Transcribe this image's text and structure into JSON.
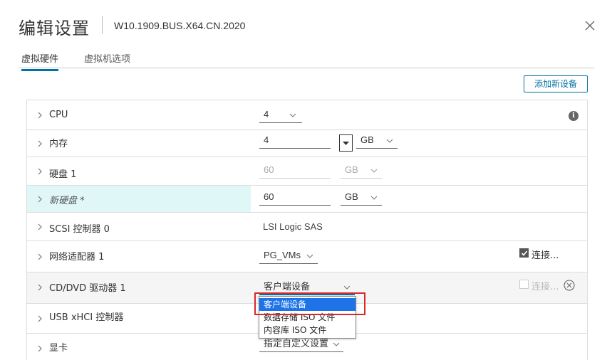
{
  "dialog": {
    "title": "编辑设置",
    "subtitle": "W10.1909.BUS.X64.CN.2020",
    "close_icon": "close-icon"
  },
  "tabs": [
    {
      "label": "虚拟硬件",
      "active": true
    },
    {
      "label": "虚拟机选项",
      "active": false
    }
  ],
  "add_device_button": "添加新设备",
  "rows": {
    "cpu": {
      "label": "CPU",
      "value": "4"
    },
    "memory": {
      "label": "内存",
      "value": "4",
      "unit": "GB"
    },
    "disk1": {
      "label": "硬盘 1",
      "value": "60",
      "unit": "GB"
    },
    "new_disk": {
      "label": "新硬盘 *",
      "value": "60",
      "unit": "GB"
    },
    "scsi": {
      "label": "SCSI 控制器 0",
      "value": "LSI Logic SAS"
    },
    "network": {
      "label": "网络适配器 1",
      "value": "PG_VMs",
      "connect_label": "连接..."
    },
    "cddvd": {
      "label": "CD/DVD 驱动器 1",
      "value": "客户端设备",
      "connect_label": "连接..."
    },
    "usb": {
      "label": "USB xHCI 控制器"
    },
    "video": {
      "label": "显卡",
      "value": "指定自定义设置"
    }
  },
  "cd_dropdown": {
    "options": [
      "客户端设备",
      "数据存储 ISO 文件",
      "内容库 ISO 文件"
    ],
    "selected_index": 0
  },
  "colors": {
    "accent": "#0072a3",
    "highlight_row": "#e0f7f7",
    "selected_option": "#1e73e8",
    "annotation_box": "#d9282a"
  }
}
